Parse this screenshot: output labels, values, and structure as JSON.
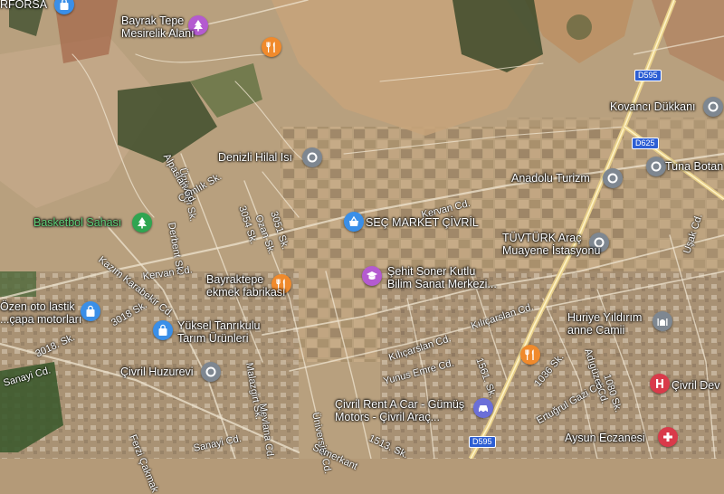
{
  "map": {
    "pois": [
      {
        "name": "Bayrak Tepe Mesirelik Alanı",
        "lines": [
          "Bayrak Tepe",
          "Mesirelik Alanı"
        ],
        "icon": "park-icon",
        "color": "#b45bd0"
      },
      {
        "name": "Denizli Hilal Isı",
        "lines": [
          "Denizli Hilal Isı"
        ],
        "icon": "location-pin-icon",
        "color": "#7e8791"
      },
      {
        "name": "Basketbol Sahası",
        "lines": [
          "Basketbol Sahası"
        ],
        "icon": "park-icon",
        "color": "#2fa551",
        "green": true
      },
      {
        "name": "SEÇ MARKET ÇİVRİL",
        "lines": [
          "SEÇ MARKET ÇİVRİL"
        ],
        "icon": "shopping-basket-icon",
        "color": "#3a8fe8"
      },
      {
        "name": "Bayraktepe ekmek fabrikası",
        "lines": [
          "Bayraktepe",
          "ekmek fabrikası"
        ],
        "icon": "restaurant-icon",
        "color": "#f08a2c"
      },
      {
        "name": "Şehit Soner Kutlu Bilim Sanat Merkezi",
        "lines": [
          "Şehit Soner Kutlu",
          "Bilim Sanat Merkezi..."
        ],
        "icon": "school-icon",
        "color": "#b45bd0"
      },
      {
        "name": "Özen oto lastik ...çapa motorları",
        "lines": [
          "Özen oto lastik",
          "...çapa motorları"
        ],
        "icon": "shopping-bag-icon",
        "color": "#3a8fe8"
      },
      {
        "name": "Yüksel Tarım Ürünleri",
        "lines": [
          "Yüksel Tanrıkulu",
          "Tarım Ürünleri"
        ],
        "icon": "shopping-bag-icon",
        "color": "#3a8fe8"
      },
      {
        "name": "Çivril Huzurevi",
        "lines": [
          "Çivril Huzurevi"
        ],
        "icon": "location-pin-icon",
        "color": "#7e8791"
      },
      {
        "name": "Çivril Rent A Car",
        "lines": [
          "Çivril Rent A Car - Gümüş",
          "Motors - Çivril Araç..."
        ],
        "icon": "car-icon",
        "color": "#6b6fd8"
      },
      {
        "name": "Kovancı Dükkanı",
        "lines": [
          "Kovancı Dükkanı"
        ],
        "icon": "location-pin-icon",
        "color": "#7e8791"
      },
      {
        "name": "Tuna Botanik",
        "lines": [
          "Tuna Botan"
        ],
        "icon": "location-pin-icon",
        "color": "#7e8791"
      },
      {
        "name": "Anadolu Turizm",
        "lines": [
          "Anadolu Turizm"
        ],
        "icon": "location-pin-icon",
        "color": "#7e8791"
      },
      {
        "name": "TÜVTÜRK Araç Muayene İstasyonu",
        "lines": [
          "TÜVTÜRK Araç",
          "Muayene İstasyonu"
        ],
        "icon": "location-pin-icon",
        "color": "#7e8791"
      },
      {
        "name": "Huriye Yıldırım anne Camii",
        "lines": [
          "Huriye Yıldırım",
          "anne Camii"
        ],
        "icon": "mosque-icon",
        "color": "#7e8791"
      },
      {
        "name": "Çivril Devlet",
        "lines": [
          "Çivril Dev"
        ],
        "icon": "hospital-icon",
        "color": "#d93a4a"
      },
      {
        "name": "Aysun Eczanesi",
        "lines": [
          "Aysun Eczanesi"
        ],
        "icon": "pharmacy-icon",
        "color": "#d93a4a"
      },
      {
        "name": "restaurant",
        "lines": [],
        "icon": "restaurant-icon",
        "color": "#f08a2c"
      },
      {
        "name": "restaurant-2",
        "lines": [],
        "icon": "restaurant-icon",
        "color": "#f08a2c"
      },
      {
        "name": "FORSA",
        "lines": [
          "RFORSA"
        ],
        "icon": "shopping-bag-icon",
        "color": "#3a8fe8"
      }
    ],
    "roads": [
      "Kervan Cd.",
      "Kervan Cd.",
      "Sanayi Cd.",
      "Sanayi Cd.",
      "Kılıçarslan Cd.",
      "Kılıçarslan Cd.",
      "Yunus Emre Cd.",
      "1561. Sk.",
      "1036 Sk.",
      "Adıgüzel Cd.",
      "1080 Sk.",
      "Ertuğrul Gazi Cd.",
      "Uşak Cd.",
      "Kazım Karabekir Cd.",
      "Derbent Sk.",
      "Çamlık Sk.",
      "Ünüvarlı Sk.",
      "Alpaslan Cd.",
      "3054 Sk.",
      "Ozan Sk.",
      "3051 Sk.",
      "3018. Sk.",
      "3018 Sk.",
      "Malazgirt Sk.",
      "Mevlana Cd.",
      "Üniversite Cd.",
      "Semerkant",
      "1513. Sk.",
      "Ferzi Çakmak"
    ],
    "highways": [
      "D595",
      "D625",
      "D595"
    ]
  }
}
